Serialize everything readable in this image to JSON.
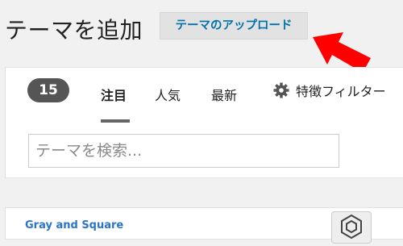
{
  "header": {
    "title": "テーマを追加",
    "upload_label": "テーマのアップロード"
  },
  "filter_bar": {
    "count": "15",
    "tabs": [
      {
        "label": "注目",
        "active": true
      },
      {
        "label": "人気",
        "active": false
      },
      {
        "label": "最新",
        "active": false
      }
    ],
    "feature_filter_label": "特徴フィルター",
    "search_placeholder": "テーマを検索..."
  },
  "theme_card": {
    "name": "Gray and Square"
  },
  "colors": {
    "accent": "#0073aa",
    "arrow": "#ff0000",
    "badge": "#555555"
  }
}
